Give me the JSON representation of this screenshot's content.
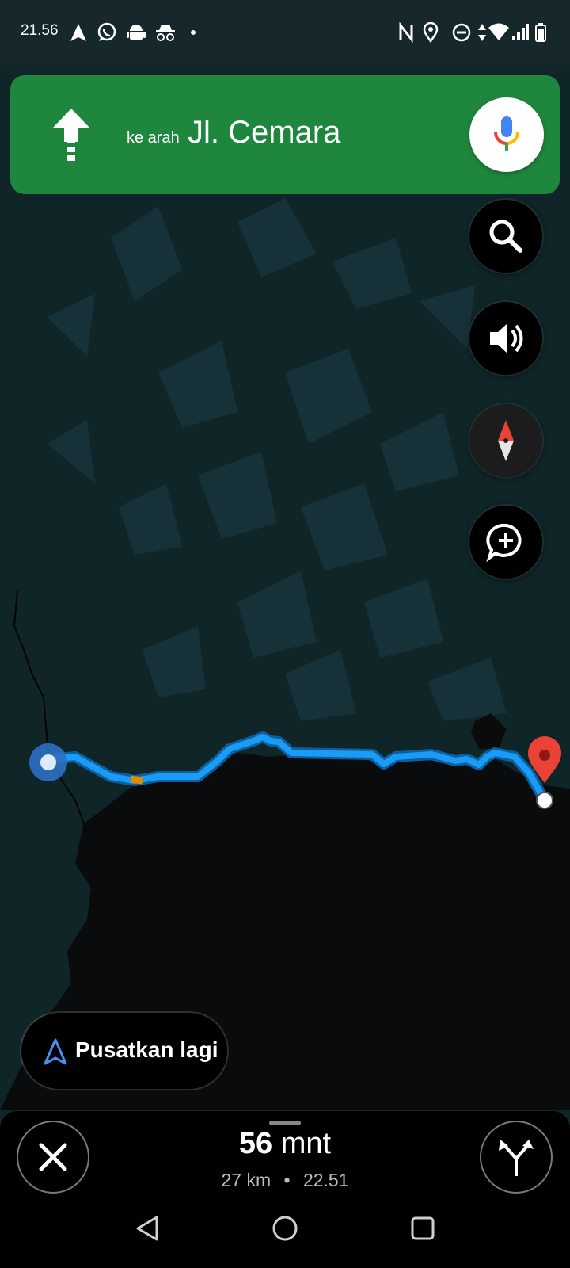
{
  "status_bar": {
    "time": "21.56",
    "left_icons": [
      "navigation-arrow-icon",
      "whatsapp-icon",
      "android-icon",
      "incognito-icon",
      "dot-icon"
    ],
    "right_icons": [
      "nfc-icon",
      "location-pin-icon",
      "do-not-disturb-icon",
      "data-arrows-icon",
      "wifi-icon",
      "signal-icon",
      "battery-icon"
    ]
  },
  "navigation_banner": {
    "direction_icon": "straight-arrow-icon",
    "prefix": "ke arah",
    "street": "Jl. Cemara",
    "background": "#1e873d"
  },
  "map_controls": {
    "buttons": [
      "search-icon",
      "volume-icon",
      "compass-icon",
      "add-report-icon"
    ]
  },
  "map": {
    "route_color": "#1a9bf5",
    "traffic_color": "#e08a00",
    "destination_marker_color": "#ea4335",
    "current_location_color": "#2d6fc4"
  },
  "recenter": {
    "label": "Pusatkan lagi"
  },
  "trip": {
    "duration_value": "56",
    "duration_unit": "mnt",
    "distance": "27 km",
    "separator": "•",
    "arrival_time": "22.51"
  },
  "system_nav": [
    "back-icon",
    "home-icon",
    "recents-icon"
  ]
}
